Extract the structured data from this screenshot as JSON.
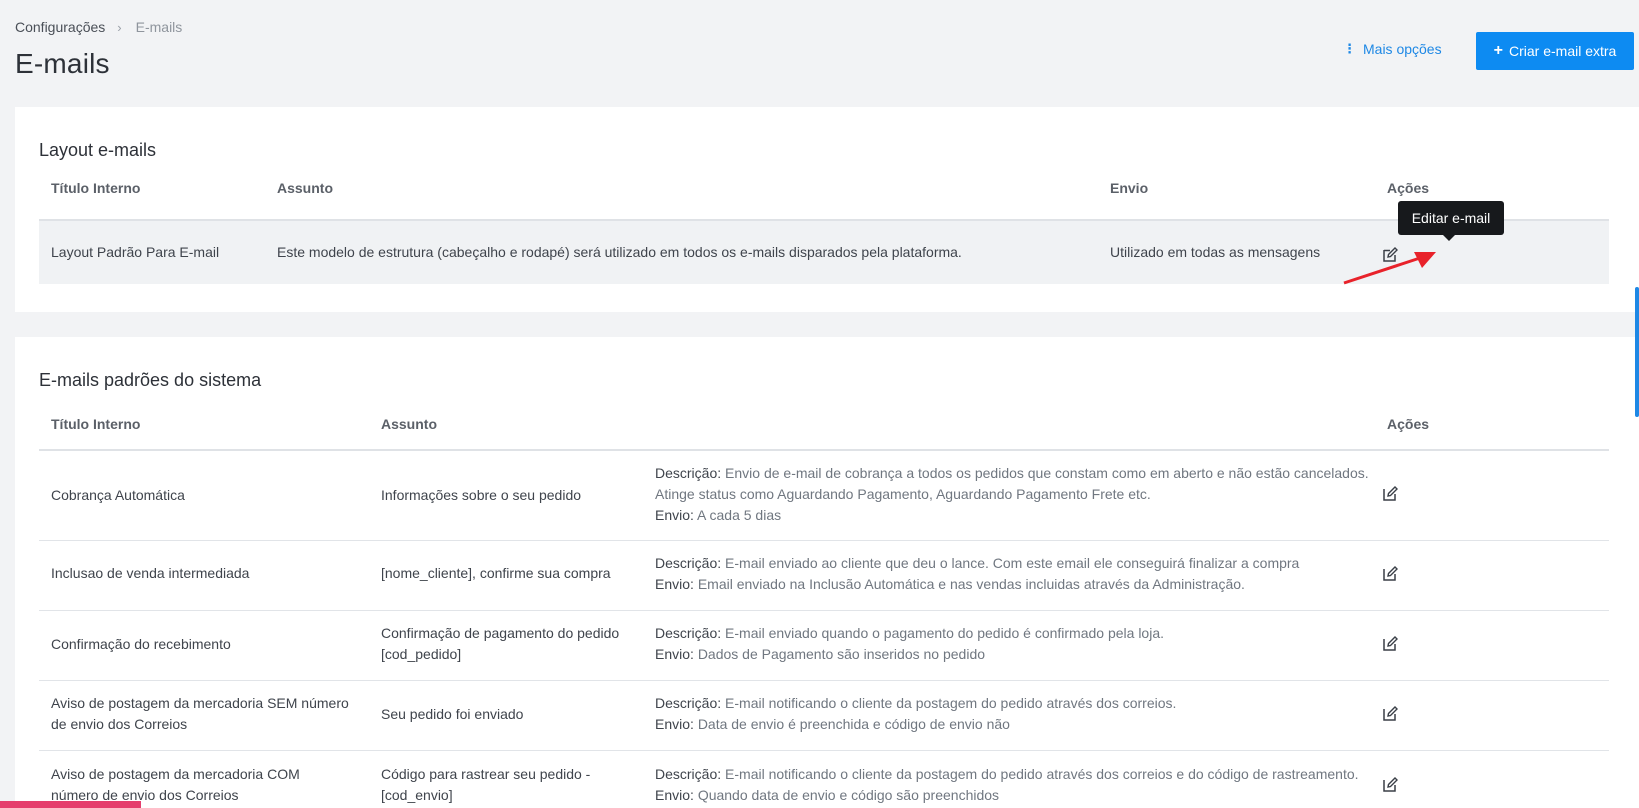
{
  "breadcrumb": {
    "root": "Configurações",
    "current": "E-mails"
  },
  "page": {
    "title": "E-mails"
  },
  "header": {
    "more_options": "Mais opções",
    "create_button": "Criar e-mail extra"
  },
  "tooltip": {
    "text": "Editar e-mail"
  },
  "layout_section": {
    "title": "Layout e-mails",
    "columns": {
      "title": "Título Interno",
      "subject": "Assunto",
      "send": "Envio",
      "actions": "Ações"
    },
    "rows": [
      {
        "title": "Layout Padrão Para E-mail",
        "subject": "Este modelo de estrutura (cabeçalho e rodapé) será utilizado em todos os e-mails disparados pela plataforma.",
        "send": "Utilizado em todas as mensagens"
      }
    ]
  },
  "system_section": {
    "title": "E-mails padrões do sistema",
    "columns": {
      "title": "Título Interno",
      "subject": "Assunto",
      "actions": "Ações"
    },
    "desc_label": "Descrição:",
    "send_label": "Envio:",
    "rows": [
      {
        "title": "Cobrança Automática",
        "subject": "Informações sobre o seu pedido",
        "desc": "Envio de e-mail de cobrança a todos os pedidos que constam como em aberto e não estão cancelados. Atinge status como Aguardando Pagamento, Aguardando Pagamento Frete etc.",
        "send": "A cada 5 dias"
      },
      {
        "title": "Inclusao de venda intermediada",
        "subject": "[nome_cliente], confirme sua compra",
        "desc": "E-mail enviado ao cliente que deu o lance. Com este email ele conseguirá finalizar a compra",
        "send": "Email enviado na Inclusão Automática e nas vendas incluidas através da Administração."
      },
      {
        "title": "Confirmação do recebimento",
        "subject": "Confirmação de pagamento do pedido [cod_pedido]",
        "desc": "E-mail enviado quando o pagamento do pedido é confirmado pela loja.",
        "send": "Dados de Pagamento são inseridos no pedido"
      },
      {
        "title": "Aviso de postagem da mercadoria SEM número de envio dos Correios",
        "subject": "Seu pedido foi enviado",
        "desc": "E-mail notificando o cliente da postagem do pedido através dos correios.",
        "send": "Data de envio é preenchida e código de envio não"
      },
      {
        "title": "Aviso de postagem da mercadoria COM número de envio dos Correios",
        "subject": "Código para rastrear seu pedido - [cod_envio]",
        "desc": "E-mail notificando o cliente da postagem do pedido através dos correios e do código de rastreamento.",
        "send": "Quando data de envio e código são preenchidos"
      }
    ]
  },
  "colors": {
    "accent": "#0d8bf2",
    "link": "#1e88e5",
    "annotation": "#e8222a"
  },
  "icons": {
    "edit": "edit-icon",
    "kebab": "kebab-icon",
    "plus": "plus-icon",
    "chevron": "chevron-right-icon"
  }
}
